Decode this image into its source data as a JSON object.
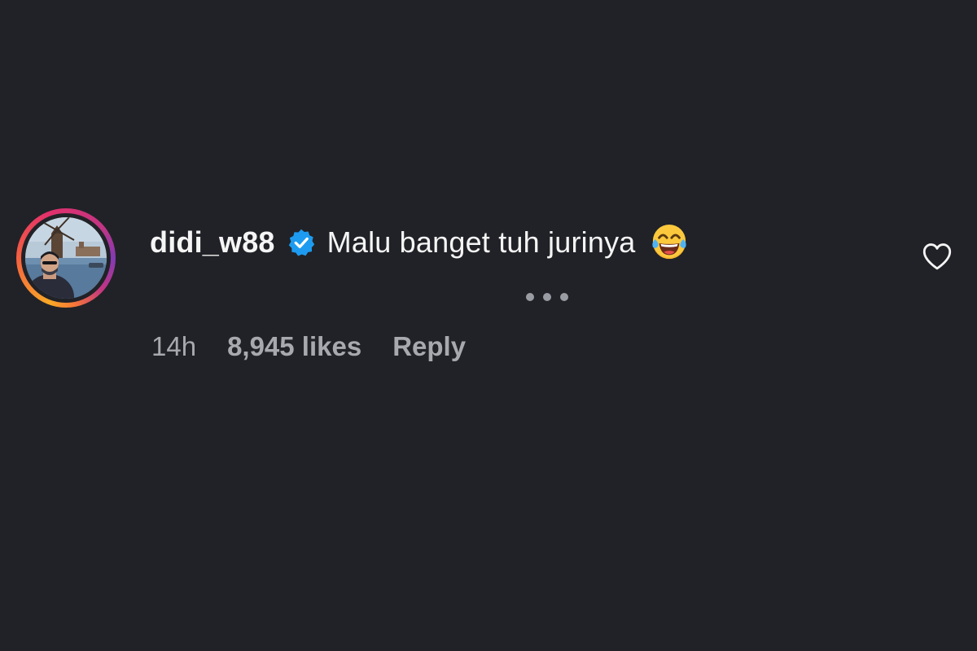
{
  "comment": {
    "username": "didi_w88",
    "verified": true,
    "text": "Malu banget tuh jurinya",
    "emoji": "face-with-tears-of-joy",
    "time": "14h",
    "likes": "8,945 likes",
    "reply_label": "Reply"
  },
  "icons": {
    "verified": "verified-badge-icon",
    "more": "more-options-icon",
    "like": "heart-outline-icon"
  },
  "colors": {
    "background": "#212227",
    "primary_text": "#f5f5f5",
    "secondary_text": "#a8a9ae",
    "verified_badge": "#1d9bf0",
    "heart_outline": "#f5f5f5"
  }
}
